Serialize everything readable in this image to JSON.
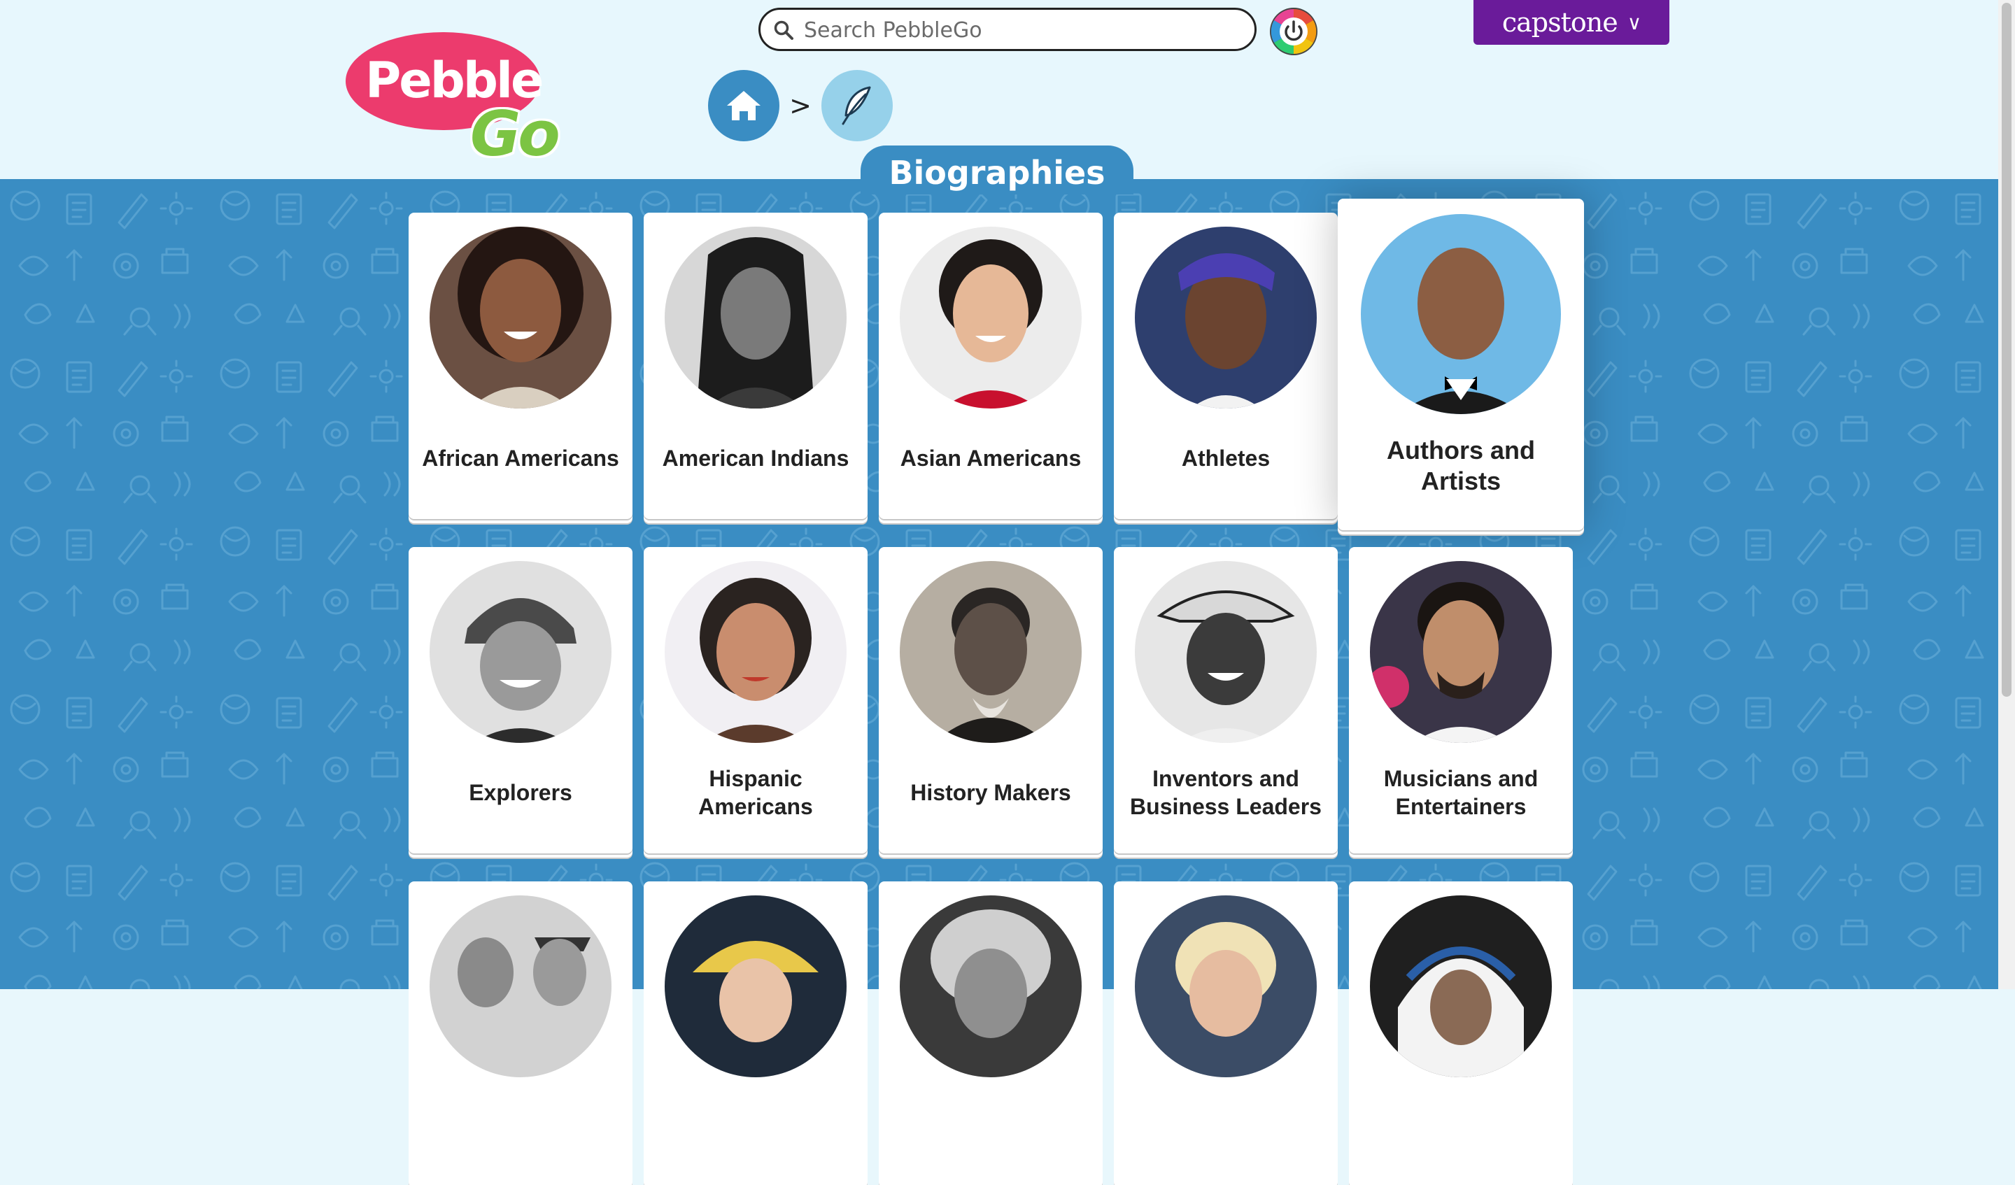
{
  "search": {
    "placeholder": "Search PebbleGo"
  },
  "logo": {
    "part1": "Pebble",
    "part2": "Go"
  },
  "capstone": {
    "label": "capstone",
    "chevron": "∨"
  },
  "breadcrumb": {
    "separator": ">"
  },
  "section": {
    "title": "Biographies"
  },
  "cards": [
    {
      "label": "African Americans"
    },
    {
      "label": "American Indians"
    },
    {
      "label": "Asian Americans"
    },
    {
      "label": "Athletes"
    },
    {
      "label": "Authors and Artists"
    },
    {
      "label": "Explorers"
    },
    {
      "label": "Hispanic Americans"
    },
    {
      "label": "History Makers"
    },
    {
      "label": "Inventors and Business Leaders"
    },
    {
      "label": "Musicians and Entertainers"
    },
    {
      "label": ""
    },
    {
      "label": ""
    },
    {
      "label": ""
    },
    {
      "label": ""
    },
    {
      "label": ""
    }
  ],
  "colors": {
    "brand_blue": "#3a8dc3",
    "header_bg": "#e7f7fd",
    "capstone_purple": "#6a1b9a",
    "logo_pink": "#ec3b6d",
    "logo_green": "#7cc443"
  }
}
